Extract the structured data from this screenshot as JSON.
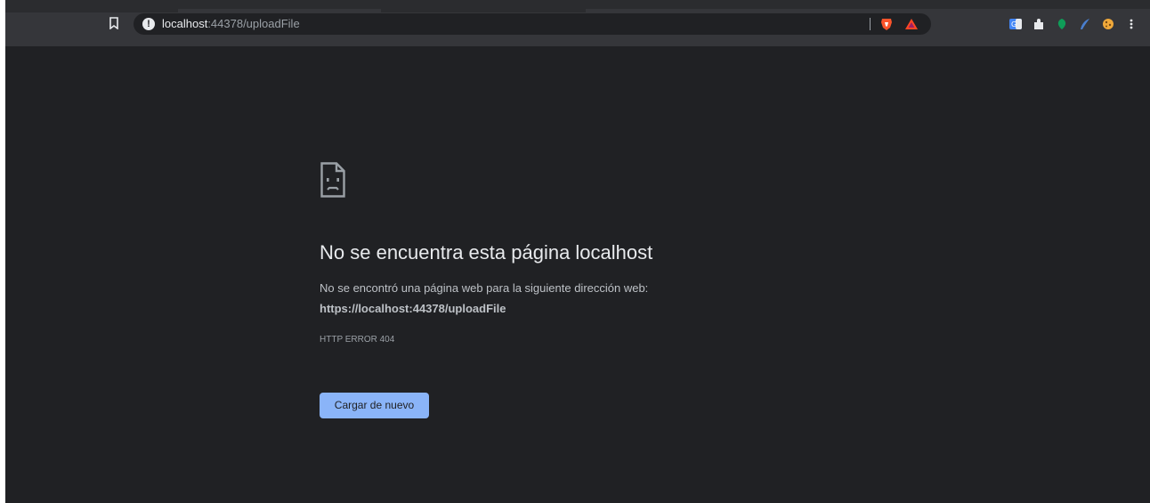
{
  "browser": {
    "address_bar": {
      "host": "localhost",
      "rest": ":44378/uploadFile"
    },
    "icons": {
      "bookmark": "bookmark-icon",
      "site_info": "info-circle-icon",
      "brave_shields": "brave-lion-icon",
      "brave_rewards": "rewards-triangle-icon",
      "extensions": [
        "translate-icon",
        "puzzle-icon",
        "green-leaf-icon",
        "feather-icon",
        "cookie-icon"
      ]
    }
  },
  "error_page": {
    "icon": "sad-page-icon",
    "heading": "No se encuentra esta página localhost",
    "description": "No se encontró una página web para la siguiente dirección web:",
    "address": "https://localhost:44378/uploadFile",
    "error_code": "HTTP ERROR 404",
    "reload_button": "Cargar de nuevo"
  },
  "colors": {
    "page_background": "#202124",
    "toolbar": "#35363a",
    "button_accent": "#8ab4f8",
    "heading_text": "#e8eaed",
    "body_text": "#bdc1c6"
  }
}
